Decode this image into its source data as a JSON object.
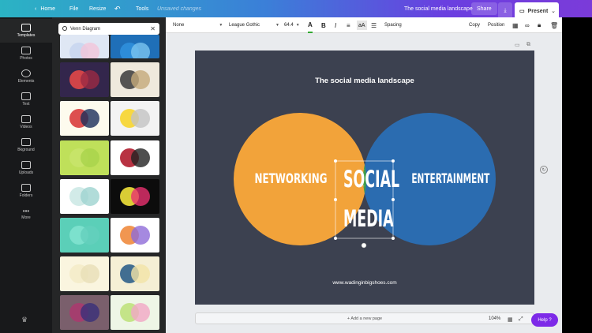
{
  "topbar": {
    "home": "Home",
    "file": "File",
    "resize": "Resize",
    "undo_icon": "undo-icon",
    "tools": "Tools",
    "unsaved": "Unsaved changes",
    "doc_title": "The social media landscape",
    "share": "Share",
    "present": "Present"
  },
  "rail": {
    "items": [
      {
        "label": "Templates",
        "icon": "templates-icon"
      },
      {
        "label": "Photos",
        "icon": "photos-icon"
      },
      {
        "label": "Elements",
        "icon": "elements-icon"
      },
      {
        "label": "Text",
        "icon": "text-icon"
      },
      {
        "label": "Videos",
        "icon": "videos-icon"
      },
      {
        "label": "Bkground",
        "icon": "background-icon"
      },
      {
        "label": "Uploads",
        "icon": "uploads-icon"
      },
      {
        "label": "Folders",
        "icon": "folders-icon"
      },
      {
        "label": "More",
        "icon": "more-icon"
      }
    ]
  },
  "panel": {
    "search_value": "Venn Diagram",
    "thumbs": [
      {
        "c1": "#c9d6f0",
        "c2": "#f2c6d9",
        "bg": "#dfe7f4"
      },
      {
        "c1": "#2f8fdc",
        "c2": "#7bc4f0",
        "bg": "#1f6fb8"
      },
      {
        "c1": "#e24848",
        "c2": "#9b2a43",
        "bg": "#33264c"
      },
      {
        "c1": "#444444",
        "c2": "#c4a97b",
        "bg": "#efe9dd"
      },
      {
        "c1": "#d93d3d",
        "c2": "#1a2e5a",
        "bg": "#fdfbee"
      },
      {
        "c1": "#f7d52e",
        "c2": "#c3c3c3",
        "bg": "#f3f3f3"
      },
      {
        "c1": "#c8e46a",
        "c2": "#a9d34b",
        "bg": "#bfe05a"
      },
      {
        "c1": "#b01c2e",
        "c2": "#222222",
        "bg": "#ffffff"
      },
      {
        "c1": "#cde9e6",
        "c2": "#9ed3cf",
        "bg": "#ffffff"
      },
      {
        "c1": "#f0e23a",
        "c2": "#e8316f",
        "bg": "#0c0c0c"
      },
      {
        "c1": "#7fe2cf",
        "c2": "#64d0bd",
        "bg": "#5bcfb8"
      },
      {
        "c1": "#f08b3e",
        "c2": "#8e6bd8",
        "bg": "#ffffff"
      },
      {
        "c1": "#f4ecc9",
        "c2": "#e9dfb6",
        "bg": "#faf5df"
      },
      {
        "c1": "#2f5f8a",
        "c2": "#f2e3a6",
        "bg": "#f5efd5"
      },
      {
        "c1": "#a83b6f",
        "c2": "#3a2f7a",
        "bg": "#7a5f6c"
      },
      {
        "c1": "#bfe27d",
        "c2": "#f1a7c6",
        "bg": "#eef6e6"
      },
      {
        "c1": "#f2a33a",
        "c2": "#2b6cb0",
        "bg": "#3a3f4e"
      }
    ]
  },
  "toolbar": {
    "fill": "None",
    "font": "League Gothic",
    "size": "64.4",
    "spacing": "Spacing",
    "copy": "Copy",
    "position": "Position"
  },
  "design": {
    "title": "The social media landscape",
    "left_label": "NETWORKING",
    "center_label_1": "SOCIAL",
    "center_label_2": "MEDIA",
    "right_label": "ENTERTAINMENT",
    "footer_url": "www.wadinginbigshoes.com",
    "colors": {
      "background": "#3c4150",
      "left_circle": "#f2a33a",
      "right_circle": "#2b6cb0",
      "overlap": "#43a047"
    }
  },
  "footer": {
    "add_page": "+ Add a new page",
    "zoom": "104%",
    "help": "Help ?"
  }
}
